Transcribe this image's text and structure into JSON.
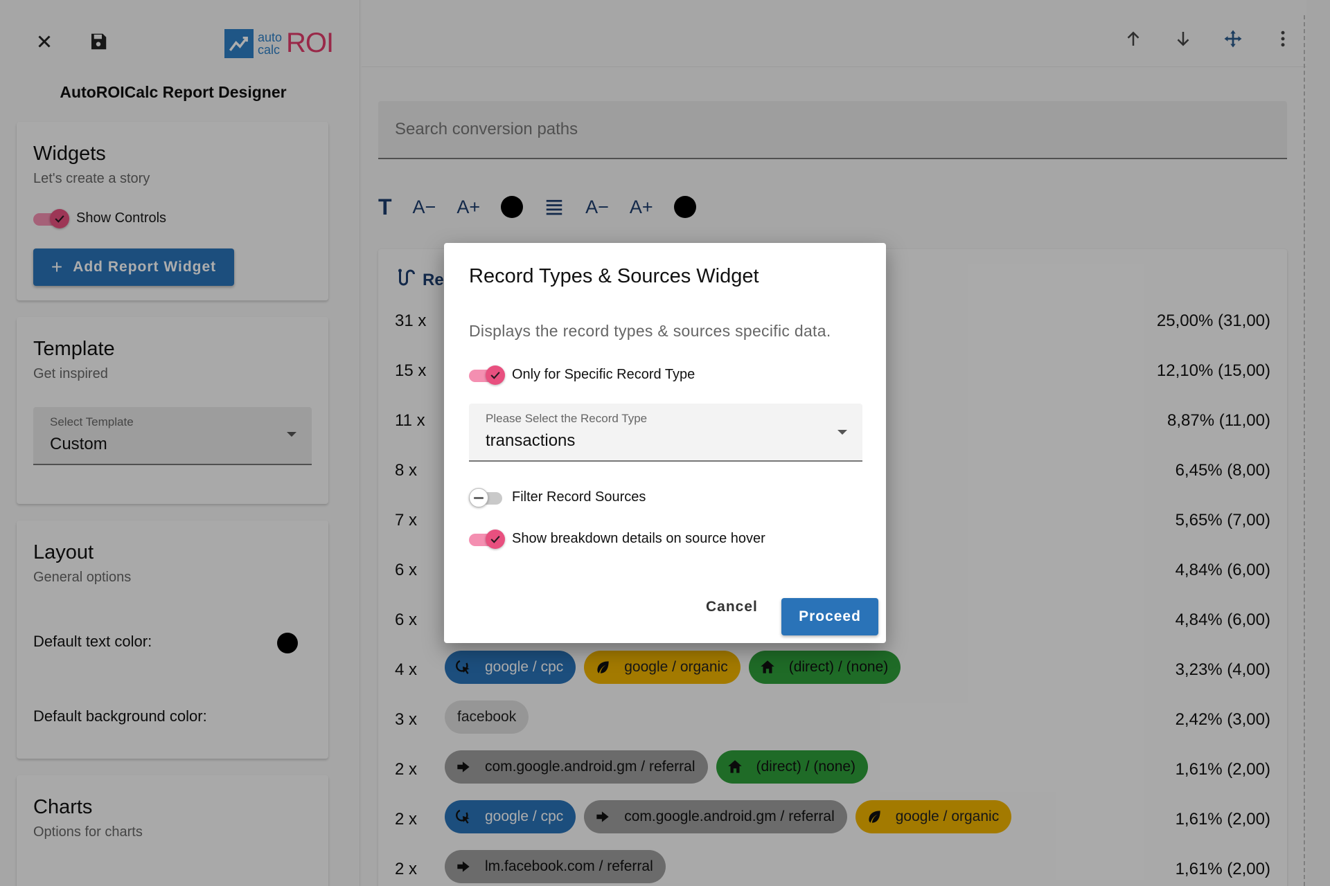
{
  "app": {
    "logo_small_top": "auto",
    "logo_small_bottom": "calc",
    "logo_big": "ROI",
    "title": "AutoROICalc Report Designer"
  },
  "sidebar": {
    "widgets": {
      "title": "Widgets",
      "subtitle": "Let's create a story",
      "show_controls_label": "Show Controls",
      "show_controls_on": true,
      "add_button": "Add Report Widget"
    },
    "template": {
      "title": "Template",
      "subtitle": "Get inspired",
      "select_label": "Select Template",
      "select_value": "Custom"
    },
    "layout": {
      "title": "Layout",
      "subtitle": "General options",
      "text_color_label": "Default text color:",
      "text_color": "#000000",
      "bg_color_label": "Default background color:"
    },
    "charts": {
      "title": "Charts",
      "subtitle": "Options for charts"
    }
  },
  "main": {
    "toolbar": [
      "arrow-up-icon",
      "arrow-down-icon",
      "move-icon",
      "more-vert-icon"
    ],
    "search_placeholder": "Search conversion paths",
    "format_bar": {
      "decrease": "A−",
      "increase": "A+",
      "text_color": "#000000"
    },
    "report_title_partial": "Re",
    "rows": [
      {
        "count": "31 x",
        "pct": "25,00% (31,00)",
        "chips": []
      },
      {
        "count": "15 x",
        "pct": "12,10% (15,00)",
        "chips": []
      },
      {
        "count": "11 x",
        "pct": "8,87% (11,00)",
        "chips": []
      },
      {
        "count": "8 x",
        "pct": "6,45% (8,00)",
        "chips": []
      },
      {
        "count": "7 x",
        "pct": "5,65% (7,00)",
        "chips": []
      },
      {
        "count": "6 x",
        "pct": "4,84% (6,00)",
        "chips": []
      },
      {
        "count": "6 x",
        "pct": "4,84% (6,00)",
        "chips": []
      },
      {
        "count": "4 x",
        "pct": "3,23% (4,00)",
        "chips": [
          {
            "label": "google / cpc",
            "type": "cpc",
            "icon": "cursor-click-icon"
          },
          {
            "label": "google / organic",
            "type": "organic",
            "icon": "leaf-icon"
          },
          {
            "label": "(direct) / (none)",
            "type": "direct",
            "icon": "home-icon"
          }
        ]
      },
      {
        "count": "3 x",
        "pct": "2,42% (3,00)",
        "chips": [
          {
            "label": "facebook",
            "type": "plain",
            "icon": ""
          }
        ]
      },
      {
        "count": "2 x",
        "pct": "1,61% (2,00)",
        "chips": [
          {
            "label": "com.google.android.gm / referral",
            "type": "referral",
            "icon": "arrow-right-icon"
          },
          {
            "label": "(direct) / (none)",
            "type": "direct",
            "icon": "home-icon"
          }
        ]
      },
      {
        "count": "2 x",
        "pct": "1,61% (2,00)",
        "chips": [
          {
            "label": "google / cpc",
            "type": "cpc",
            "icon": "cursor-click-icon"
          },
          {
            "label": "com.google.android.gm / referral",
            "type": "referral",
            "icon": "arrow-right-icon"
          },
          {
            "label": "google / organic",
            "type": "organic",
            "icon": "leaf-icon"
          }
        ]
      },
      {
        "count": "2 x",
        "pct": "1,61% (2,00)",
        "chips": [
          {
            "label": "lm.facebook.com / referral",
            "type": "referral",
            "icon": "arrow-right-icon"
          }
        ]
      }
    ]
  },
  "dialog": {
    "title": "Record Types & Sources Widget",
    "description": "Displays the record types & sources specific data.",
    "specific_record_label": "Only for Specific Record Type",
    "specific_record_on": true,
    "select_label": "Please Select the Record Type",
    "select_value": "transactions",
    "filter_sources_label": "Filter Record Sources",
    "filter_sources_on": false,
    "breakdown_label": "Show breakdown details on source hover",
    "breakdown_on": true,
    "cancel": "Cancel",
    "proceed": "Proceed"
  },
  "colors": {
    "accent": "#2a73b8",
    "toggle": "#e8507f",
    "cpc": "#2a73b8",
    "organic": "#f0b400",
    "direct": "#2e9e3a",
    "referral": "#9e9e9e"
  }
}
